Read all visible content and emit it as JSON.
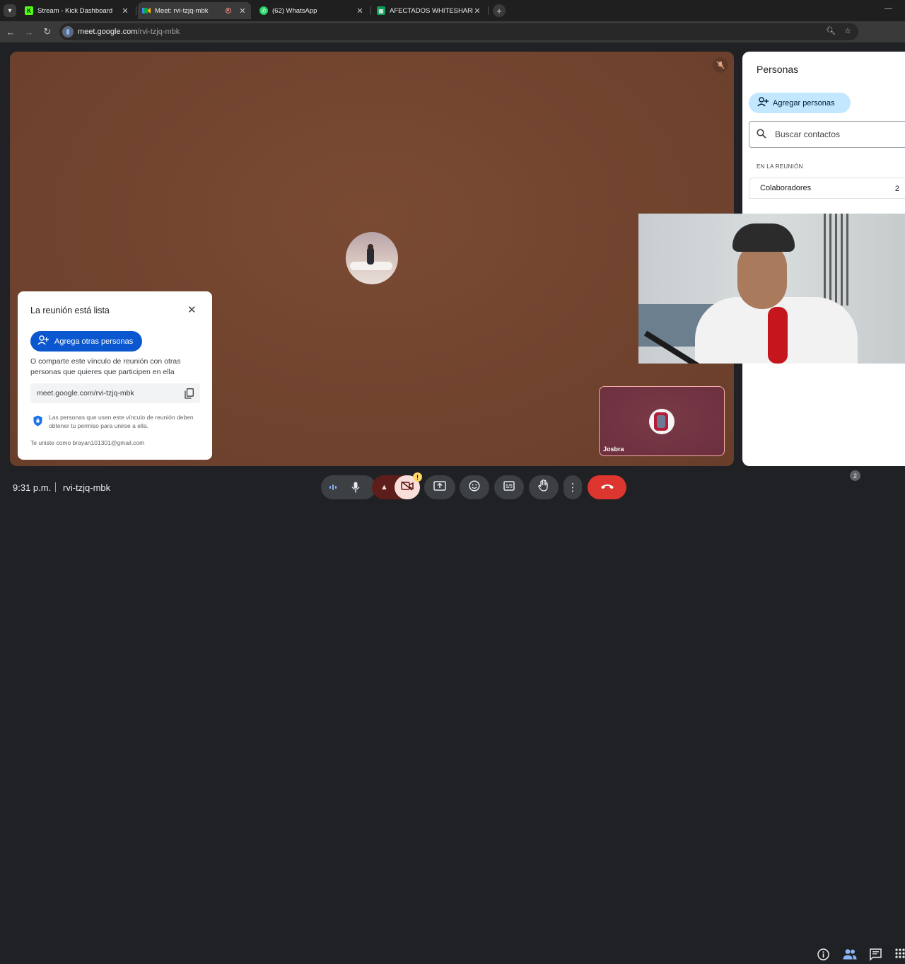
{
  "browser": {
    "tabs": [
      {
        "title": "Stream - Kick Dashboard",
        "favicon": "kick-icon",
        "favicon_color": "#53fc18",
        "active": false
      },
      {
        "title": "Meet: rvi-tzjq-mbk",
        "favicon": "meet-icon",
        "favicon_color": "#00ac47",
        "active": true,
        "recording": true
      },
      {
        "title": "(62) WhatsApp",
        "favicon": "whatsapp-icon",
        "favicon_color": "#25d366",
        "active": false
      },
      {
        "title": "AFECTADOS WHITESHARK - Ho",
        "favicon": "sheets-icon",
        "favicon_color": "#0f9d58",
        "active": false
      }
    ],
    "url_host": "meet.google.com",
    "url_path": "/rvi-tzjq-mbk"
  },
  "ready_dialog": {
    "title": "La reunión está lista",
    "add_button": "Agrega otras personas",
    "description": "O comparte este vínculo de reunión con otras personas que quieres que participen en ella",
    "link": "meet.google.com/rvi-tzjq-mbk",
    "permission_note": "Las personas que usen este vínculo de reunión deben obtener tu permiso para unirse a ella.",
    "joined_as": "Te uniste como brayan101301@gmail.com"
  },
  "self_tile": {
    "name": "Josbra"
  },
  "people_panel": {
    "title": "Personas",
    "add_button": "Agregar personas",
    "search_placeholder": "Buscar contactos",
    "section_label": "EN LA REUNIÓN",
    "collaborators_label": "Colaboradores",
    "collaborators_count": "2"
  },
  "bottom_bar": {
    "time": "9:31 p.m.",
    "meeting_code": "rvi-tzjq-mbk",
    "warning_badge": "!",
    "participants_badge": "2"
  },
  "colors": {
    "stage_bg": "#70432e",
    "end_call": "#dc362e",
    "primary_blue": "#0b57d0",
    "chip_blue": "#c2e7ff"
  }
}
